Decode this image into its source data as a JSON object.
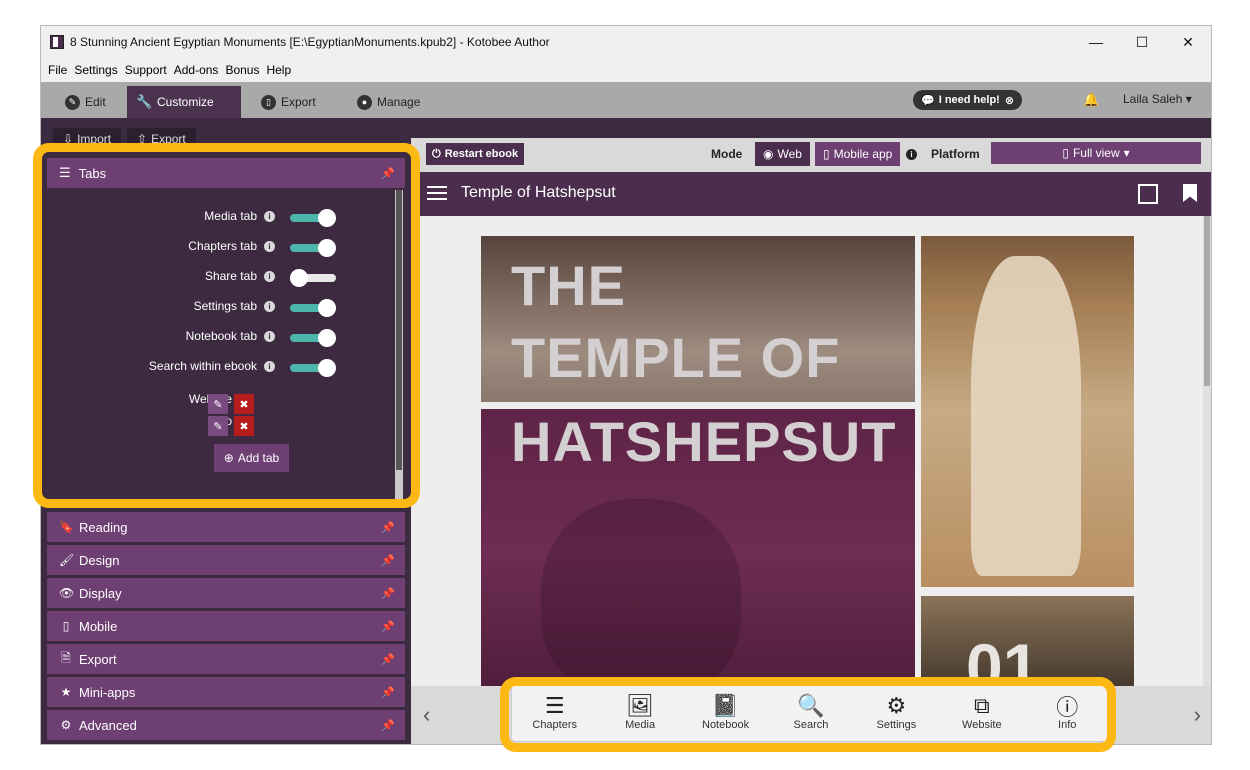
{
  "window": {
    "title": "8 Stunning Ancient Egyptian Monuments [E:\\EgyptianMonuments.kpub2] - Kotobee Author",
    "controls": [
      "—",
      "☐",
      "✕"
    ]
  },
  "menu": [
    "File",
    "Settings",
    "Support",
    "Add-ons",
    "Bonus",
    "Help"
  ],
  "nav": {
    "tabs": [
      {
        "label": "Edit",
        "icon": "pencil-circle-icon"
      },
      {
        "label": "Customize",
        "icon": "wrench-icon"
      },
      {
        "label": "Export",
        "icon": "mobile-icon"
      },
      {
        "label": "Manage",
        "icon": "user-icon"
      }
    ],
    "help_label": "I need help!",
    "user_name": "Laila Saleh"
  },
  "left": {
    "import_label": "Import",
    "export_label": "Export",
    "tabs_header": "Tabs",
    "toggles": [
      {
        "label": "Media tab",
        "on": true
      },
      {
        "label": "Chapters tab",
        "on": true
      },
      {
        "label": "Share tab",
        "on": false
      },
      {
        "label": "Settings tab",
        "on": true
      },
      {
        "label": "Notebook tab",
        "on": true
      },
      {
        "label": "Search within ebook",
        "on": true
      }
    ],
    "custom_tabs": [
      {
        "label": "Website"
      },
      {
        "label": "Info"
      }
    ],
    "add_tab_label": "Add tab",
    "sections": [
      {
        "label": "Reading",
        "icon": "bookmark-icon"
      },
      {
        "label": "Design",
        "icon": "brush-icon"
      },
      {
        "label": "Display",
        "icon": "eye-icon"
      },
      {
        "label": "Mobile",
        "icon": "mobile-icon"
      },
      {
        "label": "Export",
        "icon": "pdf-icon"
      },
      {
        "label": "Mini-apps",
        "icon": "star-icon"
      },
      {
        "label": "Advanced",
        "icon": "gear-icon"
      }
    ]
  },
  "preview": {
    "restart_label": "Restart ebook",
    "mode_label": "Mode",
    "mode_web": "Web",
    "mode_mobile": "Mobile app",
    "platform_label": "Platform",
    "platform_value": "Full view",
    "ebook_title": "Temple of Hatshepsut",
    "heading_lines": [
      "THE",
      "TEMPLE OF",
      "HATSHEPSUT"
    ],
    "chapter_number": "01",
    "tabbar": [
      {
        "label": "Chapters",
        "icon": "list-icon"
      },
      {
        "label": "Media",
        "icon": "image-icon"
      },
      {
        "label": "Notebook",
        "icon": "notebook-icon"
      },
      {
        "label": "Search",
        "icon": "search-icon"
      },
      {
        "label": "Settings",
        "icon": "gear-icon"
      },
      {
        "label": "Website",
        "icon": "external-link-icon"
      },
      {
        "label": "Info",
        "icon": "info-icon"
      }
    ]
  },
  "colors": {
    "purple_dark": "#3b2a40",
    "purple": "#6d3f72",
    "teal": "#4db6ac",
    "highlight": "#fdb913"
  }
}
